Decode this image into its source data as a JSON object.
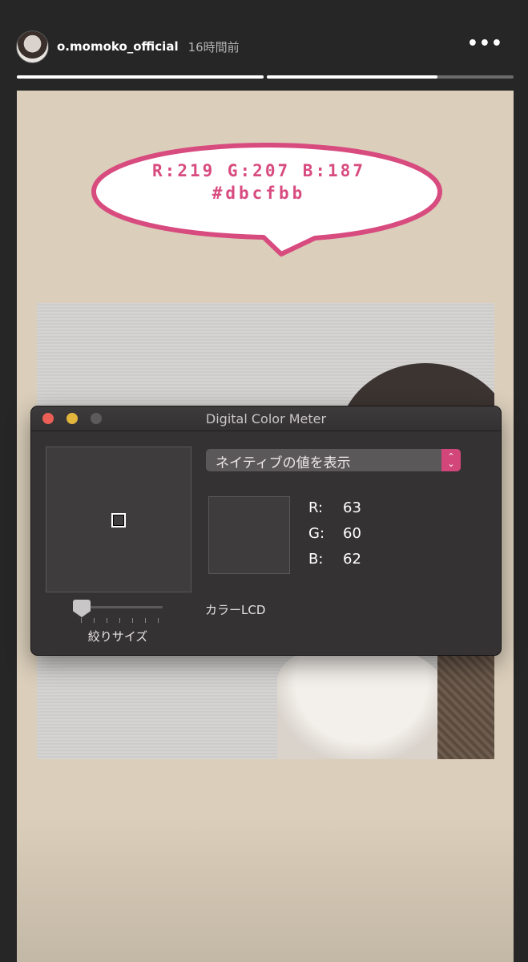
{
  "header": {
    "username": "o.momoko_official",
    "time": "16時間前",
    "more_label": "•••"
  },
  "progress": {
    "segments": [
      {
        "fill": 1.0
      },
      {
        "fill": 0.69
      }
    ]
  },
  "story": {
    "bubble": {
      "line1": "R:219 G:207 B:187",
      "line2": "#dbcfbb",
      "color": "#d84b7f"
    },
    "background_color": "#dbcfbb"
  },
  "color_meter": {
    "title": "Digital Color Meter",
    "popup_label": "ネイティブの値を表示",
    "popup_arrows": "⌃⌄",
    "values": [
      {
        "key": "R:",
        "value": "63"
      },
      {
        "key": "G:",
        "value": "60"
      },
      {
        "key": "B:",
        "value": "62"
      }
    ],
    "swatch_color": "#3f3c3e",
    "aperture_label": "絞りサイズ",
    "aperture_level": 0.0,
    "display_label": "カラーLCD"
  }
}
